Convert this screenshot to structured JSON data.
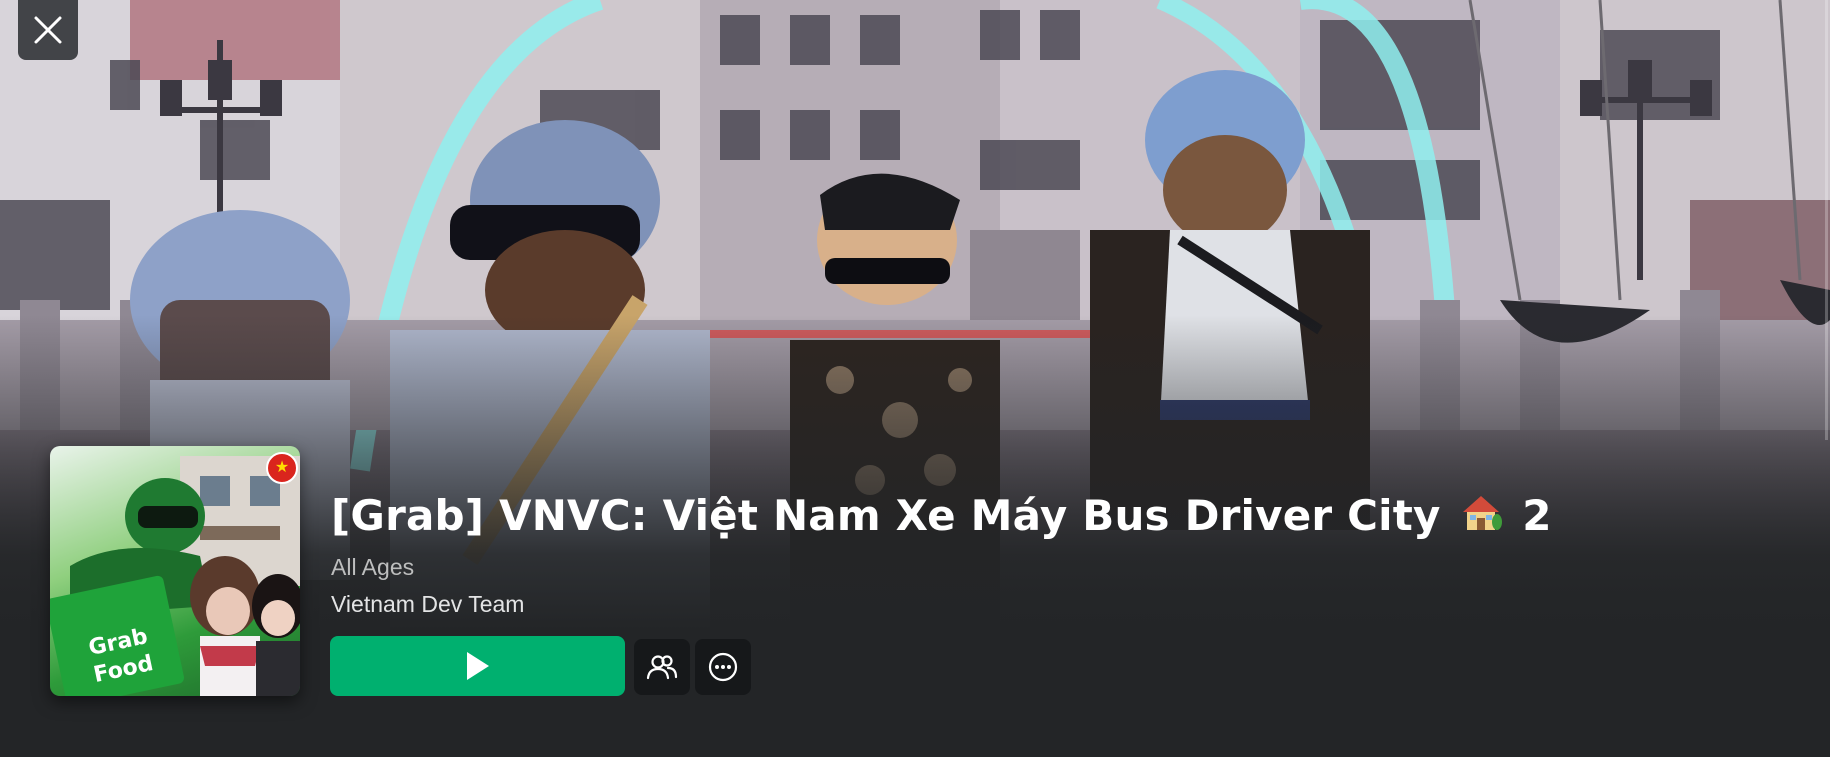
{
  "hero": {
    "close_icon": "close-icon"
  },
  "game": {
    "title": "[Grab] VNVC: Việt Nam Xe Máy Bus Driver City",
    "title_emoji": "🏡",
    "title_suffix": "2",
    "age_rating": "All Ages",
    "creator": "Vietnam Dev Team",
    "thumbnail": {
      "badge_icon": "vietnam-flag-icon",
      "badge_glyph": "★",
      "brand_text_1": "Grab",
      "brand_text_2": "Food"
    }
  },
  "actions": {
    "play_icon": "play-icon",
    "friends_icon": "friends-icon",
    "more_icon": "more-options-icon"
  },
  "colors": {
    "page_background": "#232527",
    "play_button": "#00b06f",
    "icon_button": "#16181a",
    "title_text": "#ffffff",
    "secondary_text": "#bdbebe"
  }
}
